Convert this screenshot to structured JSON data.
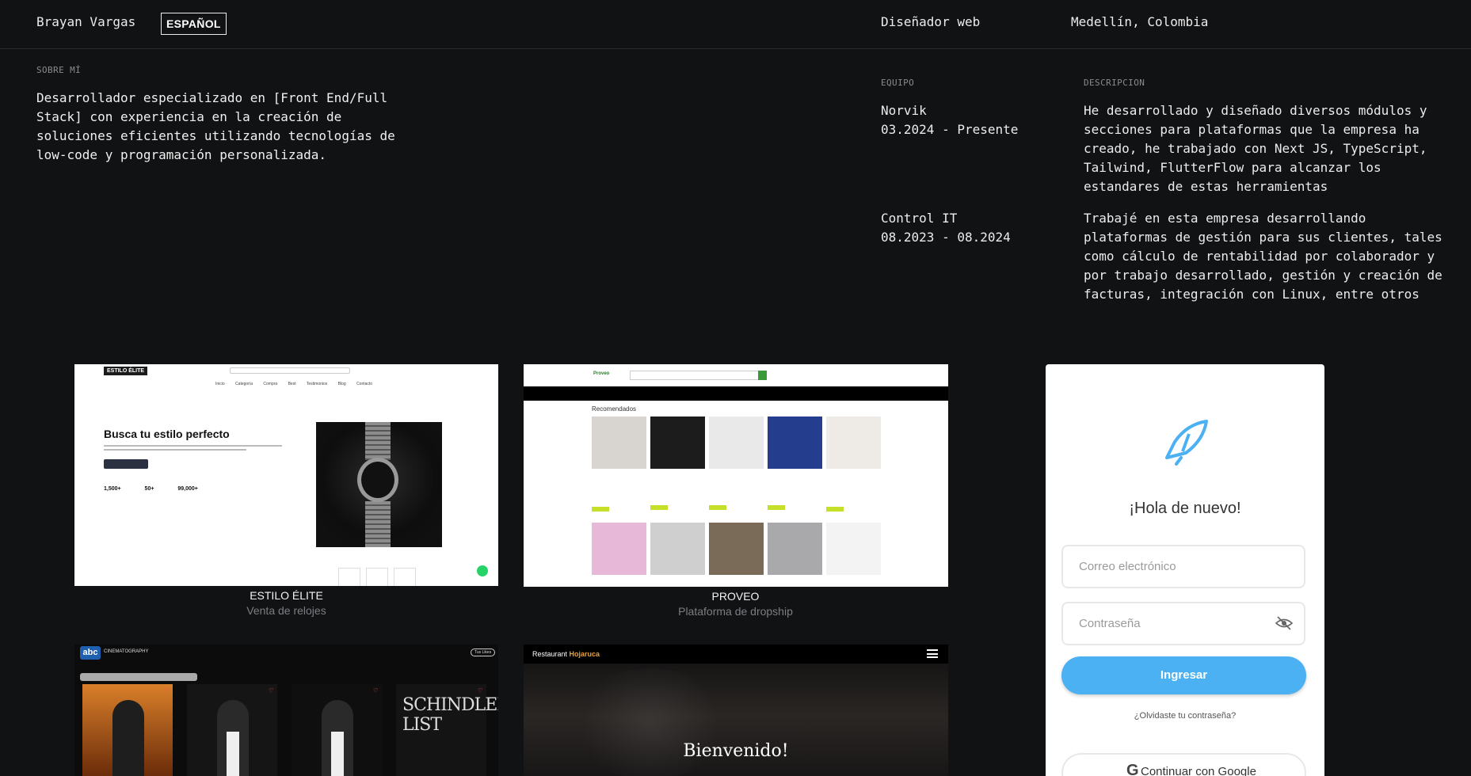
{
  "header": {
    "name": "Brayan Vargas",
    "language_button": "ESPAÑOL",
    "role": "Diseñador web",
    "location": "Medellín, Colombia"
  },
  "about": {
    "label": "SOBRE MÍ",
    "text": "Desarrollador especializado en [Front End/Full Stack] con experiencia en la creación de soluciones eficientes utilizando tecnologías de low-code y programación personalizada."
  },
  "experience": {
    "team_label": "EQUIPO",
    "desc_label": "DESCRIPCION",
    "jobs": [
      {
        "company": "Norvik",
        "period": "03.2024 - Presente",
        "description": "He desarrollado y diseñado diversos módulos y secciones para plataformas que la empresa ha creado, he trabajado con Next JS, TypeScript, Tailwind, FlutterFlow para alcanzar los estandares de estas herramientas"
      },
      {
        "company": "Control IT",
        "period": "08.2023 - 08.2024",
        "description": "Trabajé en esta empresa desarrollando plataformas de gestión para sus clientes, tales como cálculo de rentabilidad por colaborador y por trabajo desarrollado, gestión y creación de facturas, integración con Linux, entre otros"
      }
    ]
  },
  "projects": [
    {
      "title": "ESTILO ÉLITE",
      "subtitle": "Venta de relojes",
      "preview": {
        "logo": "ESTILO ÉLITE",
        "nav": "Inicio Categoría Compra Best Testimonios Blog Contacto",
        "hero": "Busca tu estilo perfecto",
        "stats": "1,500+ 50+ 99,000+"
      }
    },
    {
      "title": "PROVEO",
      "subtitle": "Plataforma de dropship",
      "preview": {
        "logo": "Proveo",
        "section": "Recomendados"
      }
    },
    {
      "preview": {
        "logo": "abc",
        "name": "CINEMATOGRAPHY",
        "pill": "Tus Likes",
        "poster_title": "SCHINDLERS LIST"
      }
    },
    {
      "preview": {
        "brand_a": "Restaurant",
        "brand_b": "Hojaruca",
        "welcome": "Bienvenido!"
      }
    }
  ],
  "login": {
    "title": "¡Hola de nuevo!",
    "email_placeholder": "Correo electrónico",
    "password_placeholder": "Contraseña",
    "submit": "Ingresar",
    "forgot": "¿Olvidaste tu contraseña?",
    "google": "Continuar con Google",
    "accent_color": "#4bb1f2"
  }
}
